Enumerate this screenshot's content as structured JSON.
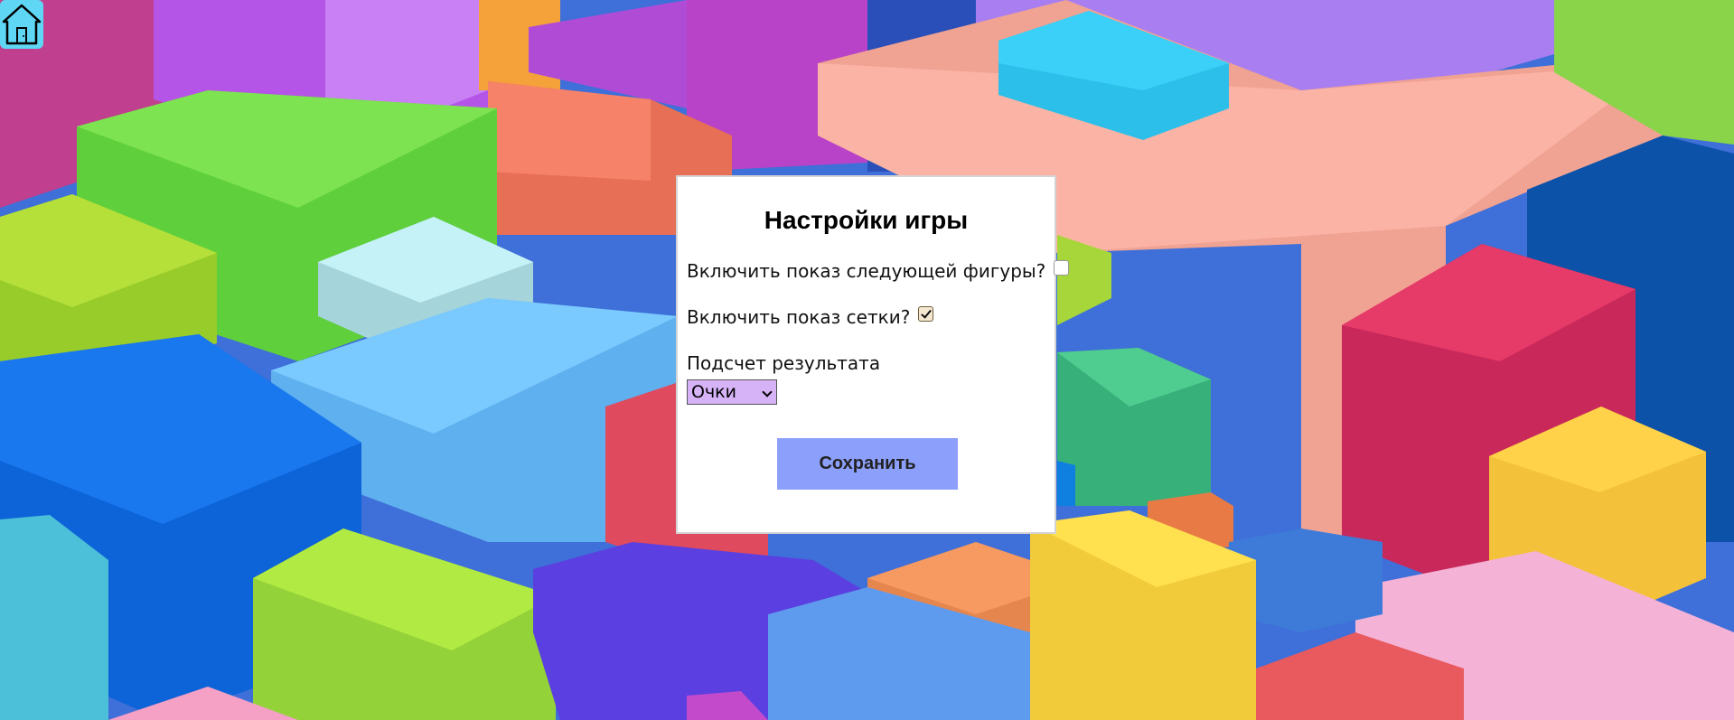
{
  "home": {
    "icon": "home-icon"
  },
  "settings": {
    "title": "Настройки игры",
    "show_next_label": "Включить показ следующей фигуры?",
    "show_next_checked": false,
    "show_grid_label": "Включить показ сетки?",
    "show_grid_checked": true,
    "score_label": "Подсчет результата",
    "score_selected": "Очки",
    "save_label": "Сохранить"
  },
  "colors": {
    "panel_bg": "#ffffff",
    "save_button": "#8c9ffb",
    "select_bg": "#d6b3f7",
    "home_button": "#5fd6f4"
  }
}
